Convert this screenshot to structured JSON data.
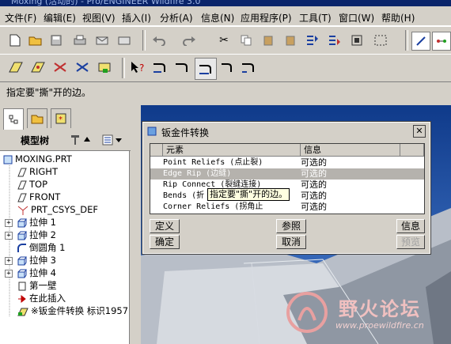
{
  "window": {
    "title": "Moxing (活动的) - Pro/ENGINEER Wildfire 3.0"
  },
  "menu": [
    "文件(F)",
    "编辑(E)",
    "视图(V)",
    "插入(I)",
    "分析(A)",
    "信息(N)",
    "应用程序(P)",
    "工具(T)",
    "窗口(W)",
    "帮助(H)"
  ],
  "message": "指定要\"撕\"开的边。",
  "panel": {
    "header": "模型树",
    "tree": [
      {
        "label": "MOXING.PRT",
        "icon": "part-icon"
      },
      {
        "label": "RIGHT",
        "icon": "datum-plane-icon"
      },
      {
        "label": "TOP",
        "icon": "datum-plane-icon"
      },
      {
        "label": "FRONT",
        "icon": "datum-plane-icon"
      },
      {
        "label": "PRT_CSYS_DEF",
        "icon": "csys-icon"
      },
      {
        "label": "拉伸 1",
        "icon": "extrude-icon"
      },
      {
        "label": "拉伸 2",
        "icon": "extrude-icon"
      },
      {
        "label": "倒圆角 1",
        "icon": "round-icon"
      },
      {
        "label": "拉伸 3",
        "icon": "extrude-icon"
      },
      {
        "label": "拉伸 4",
        "icon": "extrude-icon"
      },
      {
        "label": "第一壁",
        "icon": "wall-icon"
      },
      {
        "label": "在此插入",
        "icon": "insert-arrow-icon"
      },
      {
        "label": "※钣金件转换 标识1957",
        "icon": "conversion-icon"
      }
    ]
  },
  "dialog": {
    "title": "钣金件转换",
    "columns": [
      "元素",
      "信息"
    ],
    "rows": [
      {
        "element": "Point Reliefs (点止裂)",
        "info": "可选的"
      },
      {
        "element": "Edge Rip (边缝)",
        "info": "可选的"
      },
      {
        "element": "Rip Connect (裂缝连接)",
        "info": "可选的"
      },
      {
        "element": "Bends (折",
        "info": "可选的"
      },
      {
        "element": "Corner Reliefs (拐角止",
        "info": "可选的"
      }
    ],
    "tooltip": "指定要\"撕\"开的边。",
    "buttons": {
      "define": "定义",
      "reference": "参照",
      "info": "信息",
      "ok": "确定",
      "cancel": "取消",
      "preview": "预览"
    }
  },
  "watermark": {
    "title": "野火论坛",
    "url": "www.proewildfire.cn"
  },
  "colors": {
    "viewport": "#1a4fa0",
    "titlebar": "#0a246a",
    "selected_row": "#b5b2ad"
  }
}
